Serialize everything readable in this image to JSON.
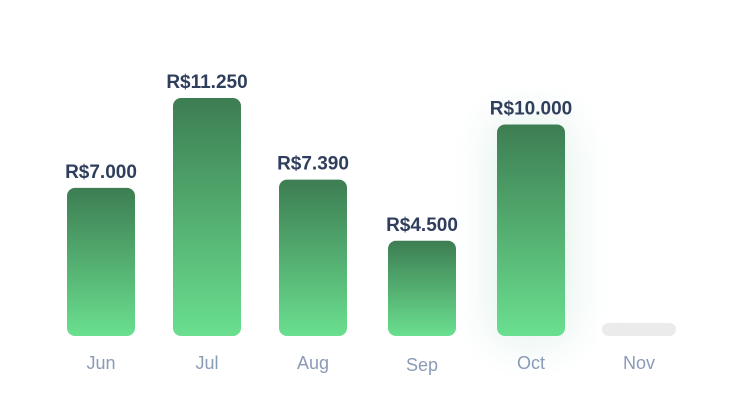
{
  "chart_data": {
    "type": "bar",
    "categories": [
      "Jun",
      "Jul",
      "Aug",
      "Sep",
      "Oct",
      "Nov"
    ],
    "values": [
      7000,
      11250,
      7390,
      4500,
      10000,
      0
    ],
    "value_labels": [
      "R$7.000",
      "R$11.250",
      "R$7.390",
      "R$4.500",
      "R$10.000",
      ""
    ],
    "highlighted_category": "Oct",
    "title": "",
    "xlabel": "",
    "ylabel": "",
    "ylim": [
      0,
      11250
    ],
    "grid": false,
    "legend": "none",
    "colors": {
      "bar_top": "#3d7d52",
      "bar_bottom": "#6adf8f",
      "empty_bar": "#ebebeb",
      "value_label": "#2f3e5c",
      "tick_label": "#8a9bb6",
      "highlight_glow": "#e3f3ec"
    }
  }
}
